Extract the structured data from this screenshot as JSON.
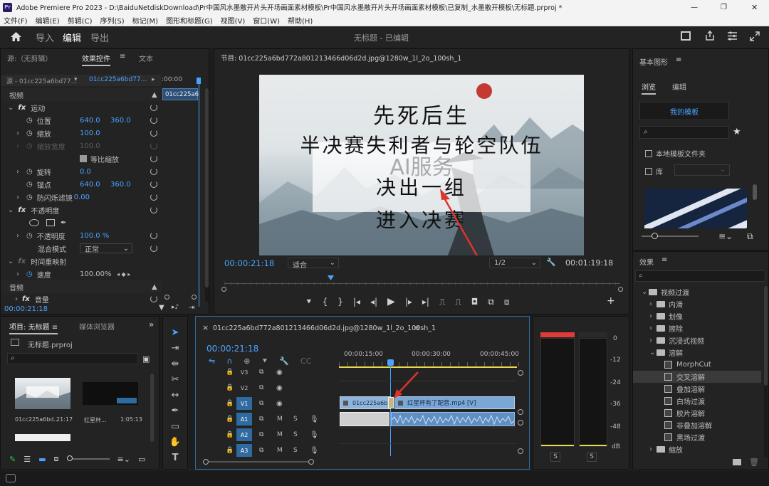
{
  "titlebar": {
    "app_icon": "Pr",
    "title": "Adobe Premiere Pro 2023 - D:\\BaiduNetdiskDownload\\Pr中国风水墨散开片头开场画面素材模板\\Pr中国风水墨散开片头开场画面素材模板\\已复制_水墨散开模板\\无标题.prproj *",
    "minimize": "—",
    "maximize": "❐",
    "close": "✕"
  },
  "menu": [
    "文件(F)",
    "编辑(E)",
    "剪辑(C)",
    "序列(S)",
    "标记(M)",
    "图形和标题(G)",
    "视图(V)",
    "窗口(W)",
    "帮助(H)"
  ],
  "workspace": {
    "tabs": [
      "导入",
      "编辑",
      "导出"
    ],
    "active_tab": "编辑",
    "project_title": "无标题 - 已编辑"
  },
  "source_panel": {
    "tabs": [
      "源:（无剪辑）",
      "效果控件",
      "文本"
    ],
    "clip_source": "源 - 01cc225a6bd77...",
    "clip_target": "01cc225a6bd77...",
    "timecode_top": ":00:00",
    "clip_bar": "01cc225a6",
    "sections": {
      "video": "视频",
      "audio": "音频"
    },
    "motion": {
      "label": "运动",
      "position": {
        "label": "位置",
        "x": "640.0",
        "y": "360.0"
      },
      "scale": {
        "label": "缩放",
        "value": "100.0"
      },
      "scale_width": {
        "label": "缩放宽度",
        "value": "100.0"
      },
      "uniform": "等比缩放",
      "rotation": {
        "label": "旋转",
        "value": "0.0"
      },
      "anchor": {
        "label": "锚点",
        "x": "640.0",
        "y": "360.0"
      },
      "antiflicker": {
        "label": "防闪烁滤镜",
        "value": "0.00"
      }
    },
    "opacity": {
      "label": "不透明度",
      "value_label": "不透明度",
      "value": "100.0 %",
      "blend_label": "混合模式",
      "blend_value": "正常"
    },
    "time_remap": {
      "label": "时间重映射",
      "speed_label": "速度",
      "speed_value": "100.00%"
    },
    "volume_label": "音量",
    "timecode": "00:00:21:18"
  },
  "program_monitor": {
    "title": "节目: 01cc225a6bd772a801213466d06d2d.jpg@1280w_1l_2o_100sh_1",
    "lines": [
      "先死后生",
      "半决赛失利者与轮空队伍",
      "决出一组",
      "进入决赛"
    ],
    "watermark": "AI服务",
    "timecode": "00:00:21:18",
    "fit": "适合",
    "quality": "1/2",
    "duration": "00:01:19:18"
  },
  "essential_graphics": {
    "title": "基本图形",
    "tabs": [
      "浏览",
      "编辑"
    ],
    "my_templates": "我的模板",
    "local_folder": "本地模板文件夹",
    "library": "库"
  },
  "effects": {
    "title": "效果",
    "tree": [
      {
        "label": "视频过渡",
        "level": 0,
        "type": "folder",
        "open": true
      },
      {
        "label": "内滑",
        "level": 1,
        "type": "folder"
      },
      {
        "label": "划像",
        "level": 1,
        "type": "folder"
      },
      {
        "label": "擦除",
        "level": 1,
        "type": "folder"
      },
      {
        "label": "沉浸式视频",
        "level": 1,
        "type": "folder"
      },
      {
        "label": "溶解",
        "level": 1,
        "type": "folder",
        "open": true
      },
      {
        "label": "MorphCut",
        "level": 2,
        "type": "fx"
      },
      {
        "label": "交叉溶解",
        "level": 2,
        "type": "fx",
        "selected": true
      },
      {
        "label": "叠加溶解",
        "level": 2,
        "type": "fx"
      },
      {
        "label": "白场过渡",
        "level": 2,
        "type": "fx"
      },
      {
        "label": "胶片溶解",
        "level": 2,
        "type": "fx"
      },
      {
        "label": "非叠加溶解",
        "level": 2,
        "type": "fx"
      },
      {
        "label": "黑场过渡",
        "level": 2,
        "type": "fx"
      },
      {
        "label": "缩放",
        "level": 1,
        "type": "folder"
      }
    ]
  },
  "project_panel": {
    "tabs": [
      "项目: 无标题",
      "媒体浏览器"
    ],
    "file": "无标题.prproj",
    "items": [
      {
        "name": "01cc225a6bd...",
        "duration": "21:17"
      },
      {
        "name": "红星杯...",
        "duration": "1:05:13"
      }
    ]
  },
  "timeline": {
    "title": "01cc225a6bd772a801213466d06d2d.jpg@1280w_1l_2o_100sh_1",
    "timecode": "00:00:21:18",
    "ruler": [
      "00:00:15:00",
      "00:00:30:00",
      "00:00:45:00"
    ],
    "tracks": [
      "V3",
      "V2",
      "V1",
      "A1",
      "A2",
      "A3"
    ],
    "clips": {
      "v1_a": "01cc225a6b",
      "v1_b": "红星杯有了配音.mp4 [V]"
    }
  },
  "audio_meter": {
    "scale": [
      "0",
      "-12",
      "-24",
      "-36",
      "-48",
      "dB"
    ],
    "solo_labels": [
      "S",
      "S"
    ]
  },
  "colors": {
    "accent": "#4aa3ff",
    "clip_video": "#8fb4dc",
    "clip_audio": "#7aa7d6",
    "playhead": "#4aa3ff",
    "annotation_arrow": "#e0332b"
  }
}
